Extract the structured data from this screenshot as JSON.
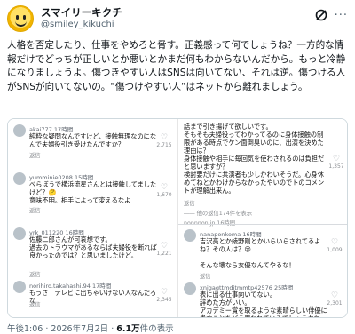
{
  "author": {
    "display_name": "スマイリーキクチ",
    "handle": "@smiley_kikuchi"
  },
  "post": {
    "text": "人格を否定したり、仕事をやめろと脅す。正義感って何でしょうね？一方的な情報だけでどっちが正しいとか悪いとかまだ何もわからないんだから。もっと冷静になりましょうよ。傷つきやすい人はSNSは向いてない、それは逆。傷つける人がSNSが向いてないの。“傷つけやすい人”はネットから離れましょう。"
  },
  "screenshot_left": {
    "comments": [
      {
        "user": "akai777",
        "time": "17時間",
        "text": "純粋な疑問なんですけど、接触無理なのになんで夫婦役引き受けたんですか？",
        "reply": "返信",
        "likes": "2,715"
      },
      {
        "user": "yumminie0208",
        "time": "15時間",
        "text": "べらぼうで横浜流星さんとは接触してましたけど？🤔\n意味不明。相手によって変えるなよ",
        "reply": "返信",
        "likes": "1,670"
      },
      {
        "user": "yrk_011220",
        "time": "16時間",
        "text": "佐藤二郎さんが可哀想です。\n過去のトラウマがあるならば夫婦役を断れば良かったのでは？と思いましたけど。",
        "reply": "返信",
        "likes": "1,221"
      },
      {
        "user": "norihiro.takahashi.94",
        "time": "17時間",
        "text": "もうさ　テレビに出ちゃいけない人なんだろな",
        "reply": "返信",
        "likes": "2,345"
      }
    ]
  },
  "screenshot_right": {
    "top_text": "話まで引き揚げて欲しいです。\nそもそも夫婦役ってわかってるのに身体接触の制限がある時点でケン面倒臭いのに、出演を決めた理由は？\n身体接触や相手に毎回気を使わされるのは負担だと思いますが？\n検討要だけに共演者も少しかわいそうだ。心身休めてねとかわけからなかったやいのでトのコメントが理解出来ん。",
    "top_reply": "返信",
    "top_likes": "1,357",
    "hidden_link": "―― 他の返信174件を表示",
    "cut_user": "nonnnon.jp 16時間",
    "comments": [
      {
        "user": "nanaponkoma",
        "time": "16時間",
        "text": "吉沢亮とか綾野剛とかいらいらされてるよね？その人は？😒\n\nそんな壊なら女優なんてやるな！",
        "reply": "返信",
        "likes": "1,009"
      },
      {
        "user": "xnjgagttmdjtmmtp42576",
        "time": "25時間",
        "text": "表に出る仕事向いてない。\n辞めた方がいい。\nアカデミー賞を取るような素晴らしい俳優に貴方ことをどう思われているでしょうかね。",
        "reply": "返信",
        "likes": "2,301"
      }
    ]
  },
  "meta": {
    "time": "午後1:06",
    "date": "2026年7月2日",
    "views": "6.1万",
    "views_suffix": "件の表示"
  },
  "icons": [
    "grok-icon",
    "more-icon",
    "heart-icon"
  ]
}
